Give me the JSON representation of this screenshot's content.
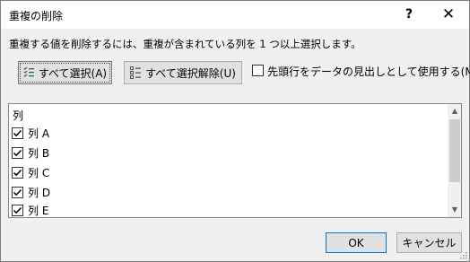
{
  "window": {
    "title": "重複の削除"
  },
  "titlebar": {
    "help_label": "?",
    "close_label": "✕"
  },
  "description": "重複する値を削除するには、重複が含まれている列を 1 つ以上選択します。",
  "buttons": {
    "select_all": "すべて選択(A)",
    "deselect_all": "すべて選択解除(U)",
    "ok": "OK",
    "cancel": "キャンセル"
  },
  "header_option": {
    "label": "先頭行をデータの見出しとして使用する(M)",
    "checked": false
  },
  "columns": {
    "header": "列",
    "items": [
      {
        "label": "列 A",
        "checked": true
      },
      {
        "label": "列 B",
        "checked": true
      },
      {
        "label": "列 C",
        "checked": true
      },
      {
        "label": "列 D",
        "checked": true
      },
      {
        "label": "列 E",
        "checked": true
      }
    ]
  },
  "icons": {
    "select_all": "checklist-select-icon",
    "deselect_all": "checklist-deselect-icon",
    "accent": "#0078d7",
    "check_color": "#217346"
  }
}
